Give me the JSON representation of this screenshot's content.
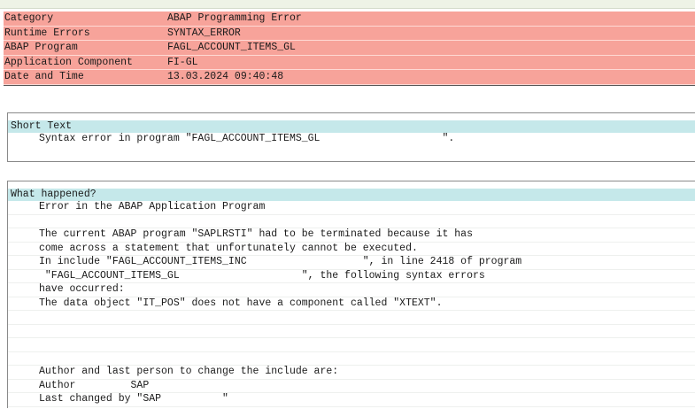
{
  "header": {
    "rows": [
      {
        "key": "Category",
        "value": "ABAP Programming Error"
      },
      {
        "key": "Runtime Errors",
        "value": "SYNTAX_ERROR"
      },
      {
        "key": "ABAP Program",
        "value": "FAGL_ACCOUNT_ITEMS_GL"
      },
      {
        "key": "Application Component",
        "value": "FI-GL"
      },
      {
        "key": "Date and Time",
        "value": "13.03.2024 09:40:48"
      }
    ]
  },
  "short_text": {
    "title": "Short Text",
    "line": "Syntax error in program \"FAGL_ACCOUNT_ITEMS_GL                    \"."
  },
  "what_happened": {
    "title": "What happened?",
    "lines": [
      "Error in the ABAP Application Program",
      "",
      "The current ABAP program \"SAPLRSTI\" had to be terminated because it has",
      "come across a statement that unfortunately cannot be executed.",
      "In include \"FAGL_ACCOUNT_ITEMS_INC                   \", in line 2418 of program",
      " \"FAGL_ACCOUNT_ITEMS_GL                    \", the following syntax errors",
      "have occurred:",
      "The data object \"IT_POS\" does not have a component called \"XTEXT\".",
      "",
      "",
      "",
      "",
      "Author and last person to change the include are:",
      "Author         SAP",
      "Last changed by \"SAP          \""
    ]
  },
  "colors": {
    "header_bg": "#f7a39a",
    "section_title_bg": "#c5e8ea"
  }
}
